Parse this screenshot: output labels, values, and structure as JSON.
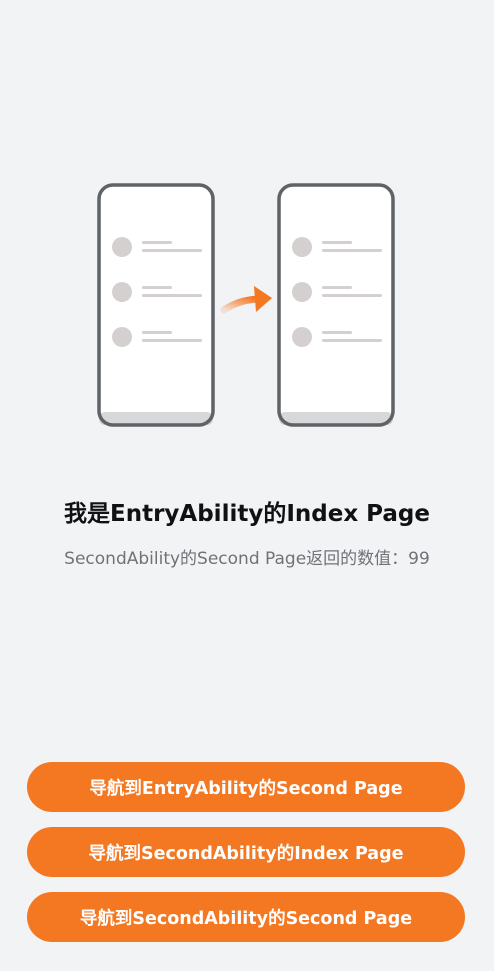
{
  "page": {
    "title": "我是EntryAbility的Index Page",
    "result_text": "SecondAbility的Second Page返回的数值：99"
  },
  "illustration": {
    "icon": "page-navigation-illustration",
    "accent_color": "#f47722"
  },
  "buttons": [
    {
      "label": "导航到EntryAbility的Second Page"
    },
    {
      "label": "导航到SecondAbility的Index Page"
    },
    {
      "label": "导航到SecondAbility的Second Page"
    }
  ],
  "colors": {
    "background": "#f1f3f5",
    "button": "#f47722",
    "button_text": "#ffffff"
  }
}
